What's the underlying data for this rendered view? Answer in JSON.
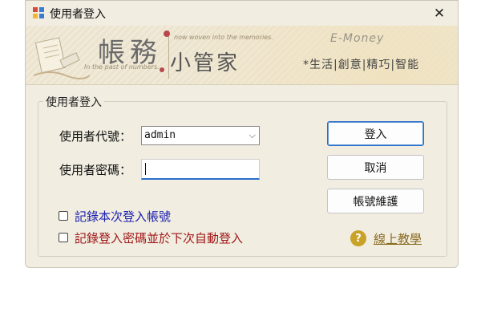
{
  "window": {
    "title": "使用者登入",
    "close_glyph": "✕"
  },
  "banner": {
    "title_big": "帳務",
    "title_small": "小管家",
    "tagline_left": "In the past of numbers.",
    "tagline_top": "now woven into the memories.",
    "brand": "E-Money",
    "slogan": "*生活|創意|精巧|智能"
  },
  "form": {
    "group_title": "使用者登入",
    "user_label": "使用者代號：",
    "user_value": "admin",
    "password_label": "使用者密碼：",
    "remember_user_label": "記錄本次登入帳號",
    "remember_password_label": "記錄登入密碼並於下次自動登入",
    "remember_user_checked": false,
    "remember_password_checked": false
  },
  "buttons": {
    "login": "登入",
    "cancel": "取消",
    "account_maintenance": "帳號維護"
  },
  "help": {
    "link": "線上教學",
    "icon": "?"
  },
  "colors": {
    "window_bg": "#f1ede1",
    "remember_user_text": "#1a1fb0",
    "remember_password_text": "#a01818",
    "help_link": "#8a6a1f",
    "accent": "#2a6fc9"
  }
}
